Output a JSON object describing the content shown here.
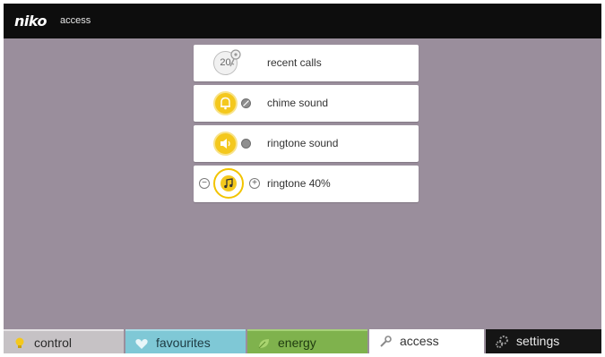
{
  "header": {
    "brand": "niko",
    "section": "access"
  },
  "menu": {
    "recent_calls": {
      "badge": "20",
      "label": "recent calls"
    },
    "chime_sound": {
      "label": "chime sound"
    },
    "ringtone_sound": {
      "label": "ringtone sound"
    },
    "ringtone_volume": {
      "label": "ringtone 40%",
      "minus": "−",
      "plus": "+",
      "level_percent": 40
    }
  },
  "tabs": {
    "control": "control",
    "favourites": "favourites",
    "energy": "energy",
    "access": "access",
    "settings": "settings"
  },
  "colors": {
    "background": "#9a8e9c",
    "topbar": "#0d0d0d",
    "accent_yellow": "#f4c81d",
    "tab_control": "#c6c2c5",
    "tab_favourites": "#7fc8d6",
    "tab_energy": "#7fb24d",
    "tab_access": "#ffffff",
    "tab_settings": "#151515"
  },
  "icons": [
    "bulb-icon",
    "heart-icon",
    "leaf-icon",
    "wrench-icon",
    "gears-icon",
    "key-icon",
    "bell-icon",
    "speaker-icon",
    "music-note-icon",
    "mute-icon"
  ]
}
